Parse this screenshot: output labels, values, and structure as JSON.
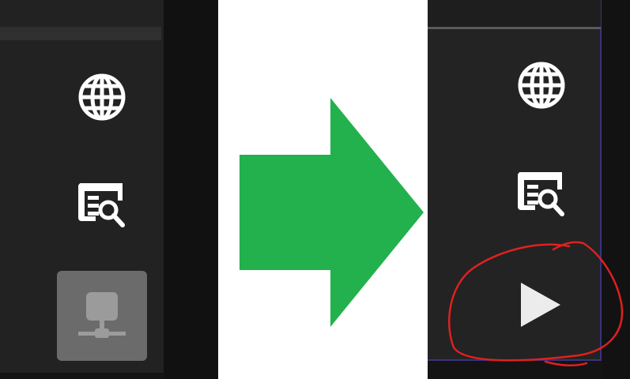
{
  "panels": {
    "before": {
      "icons": [
        "globe-icon",
        "search-document-icon",
        "network-icon"
      ],
      "active_icon": "network-icon"
    },
    "after": {
      "icons": [
        "globe-icon",
        "search-document-icon",
        "play-icon"
      ],
      "highlighted_icon": "play-icon"
    }
  },
  "colors": {
    "panel_bg": "#222222",
    "arrow": "#22b14c",
    "highlight_circle": "#e02020",
    "active_tile": "#6b6b6b",
    "frame_border": "#3a3280"
  }
}
